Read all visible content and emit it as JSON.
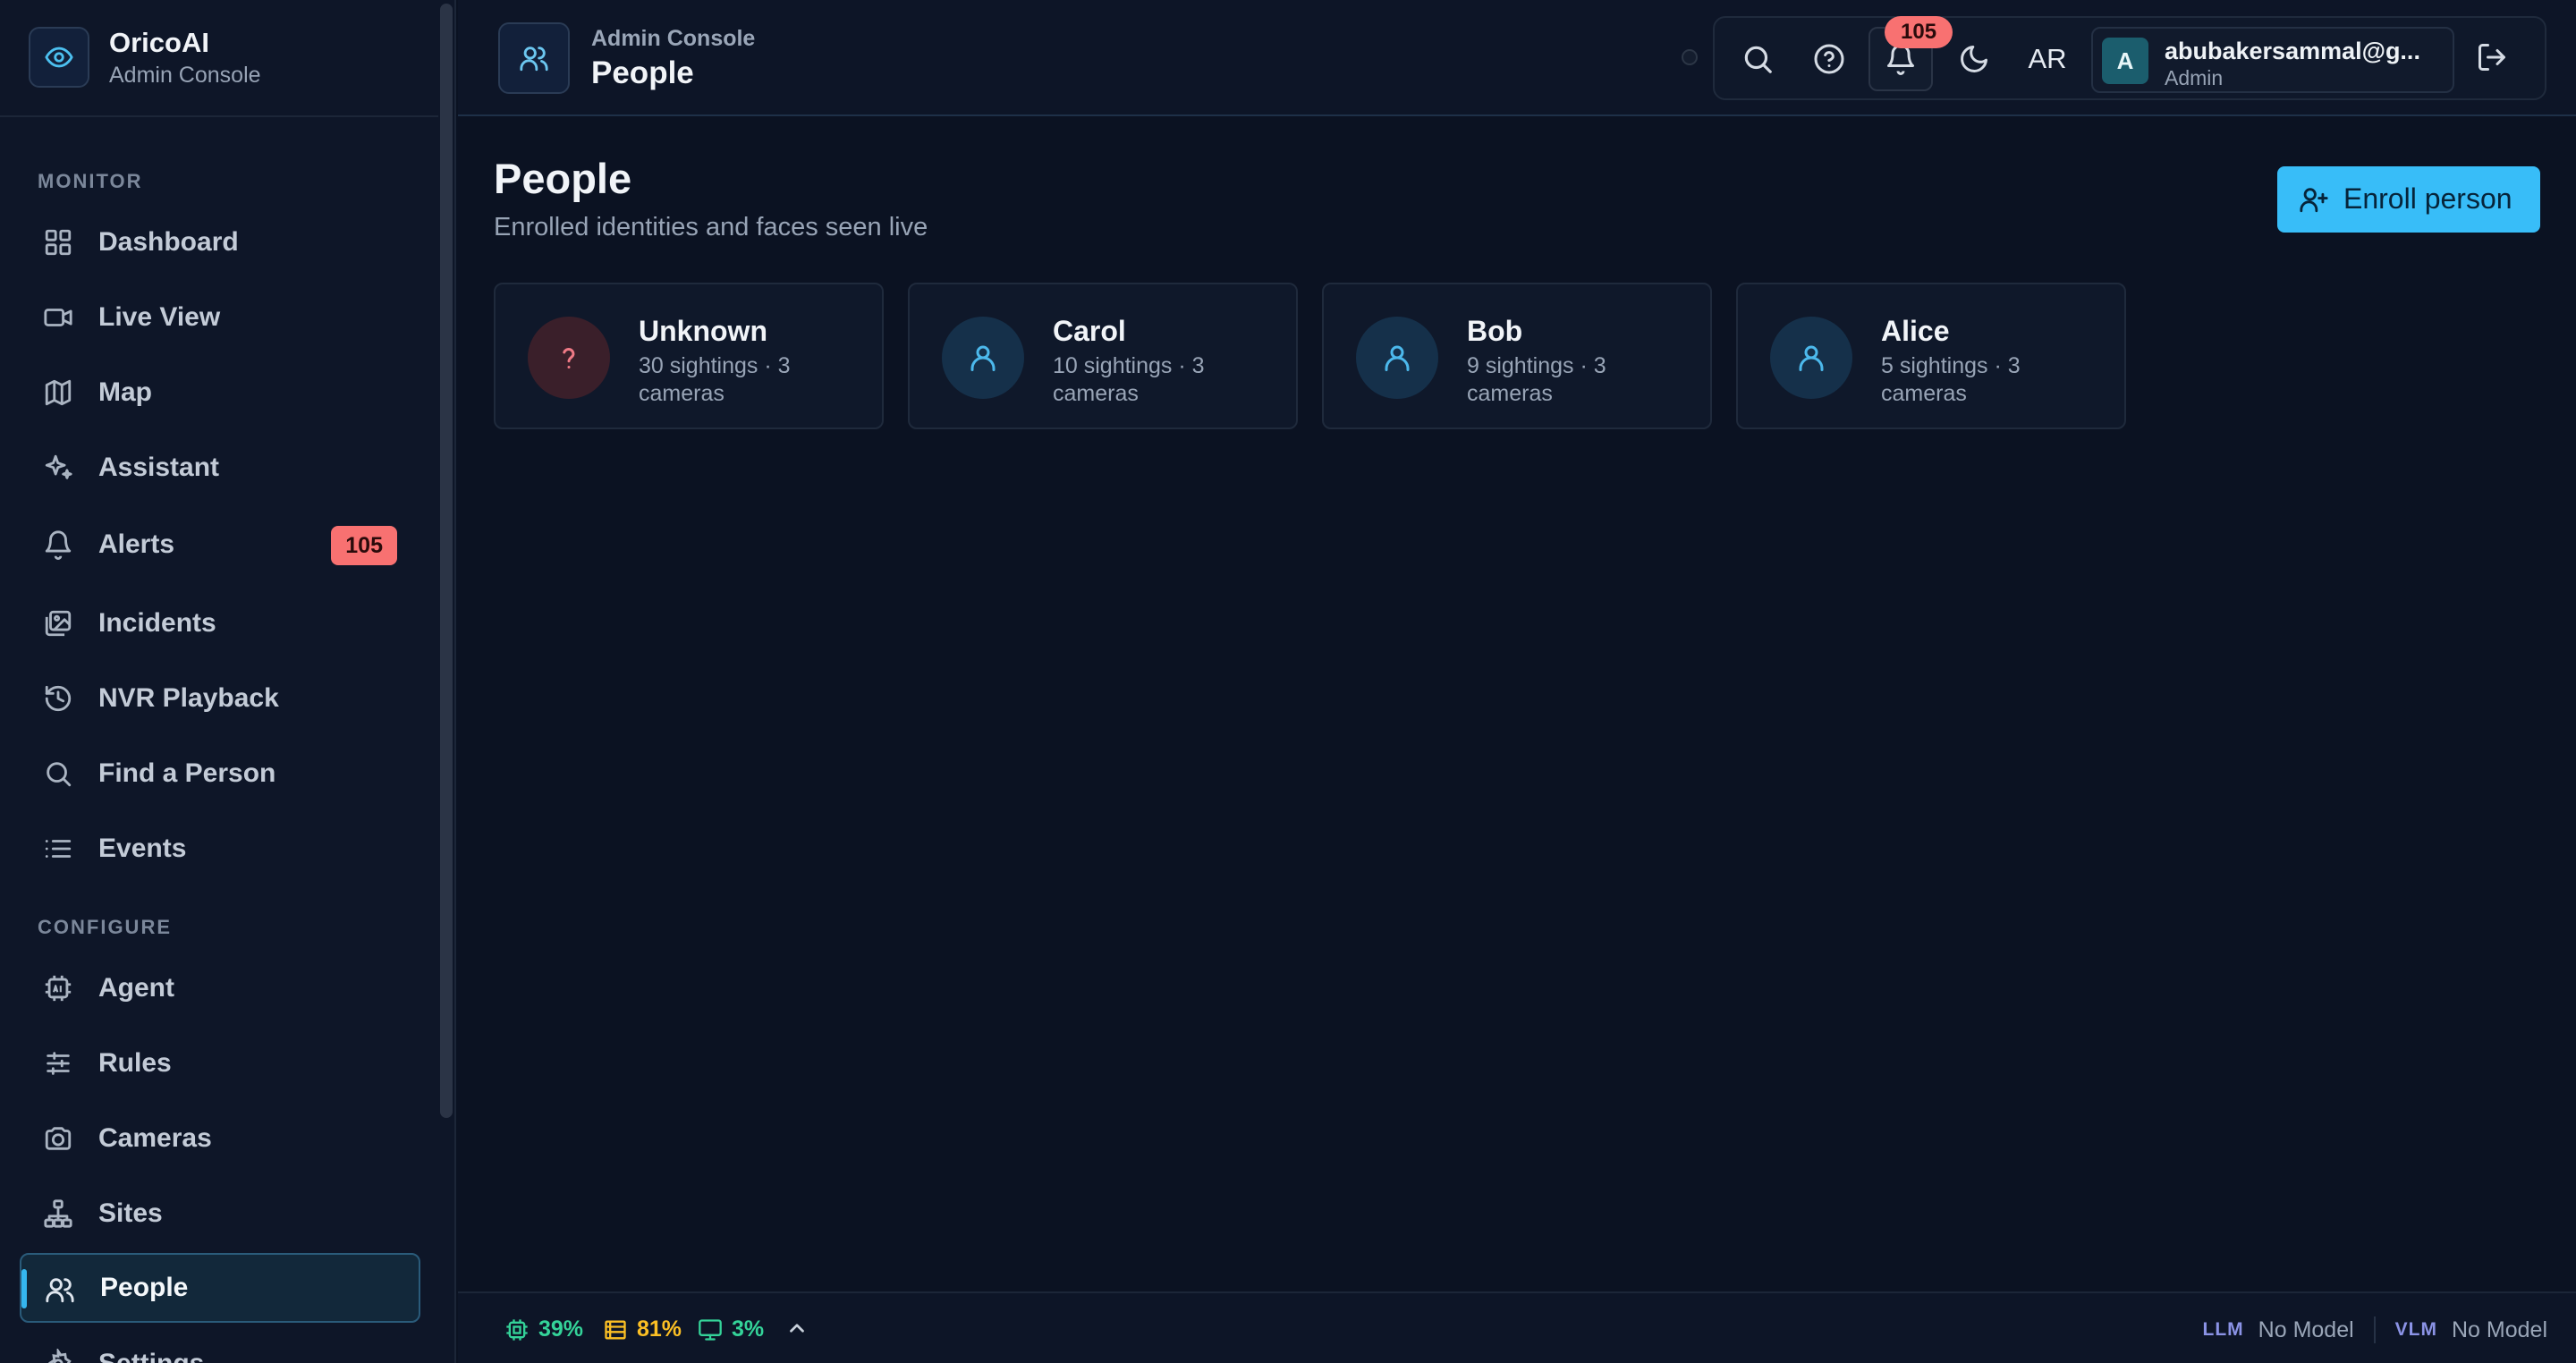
{
  "brand": {
    "name": "OricoAI",
    "subtitle": "Admin Console"
  },
  "sidebar": {
    "sections": [
      {
        "label": "MONITOR"
      },
      {
        "label": "CONFIGURE"
      }
    ],
    "items": [
      {
        "label": "Dashboard",
        "icon": "grid-icon"
      },
      {
        "label": "Live View",
        "icon": "video-camera-icon"
      },
      {
        "label": "Map",
        "icon": "map-icon"
      },
      {
        "label": "Assistant",
        "icon": "sparkles-icon"
      },
      {
        "label": "Alerts",
        "icon": "bell-icon",
        "badge": "105"
      },
      {
        "label": "Incidents",
        "icon": "images-icon"
      },
      {
        "label": "NVR Playback",
        "icon": "history-icon"
      },
      {
        "label": "Find a Person",
        "icon": "search-icon"
      },
      {
        "label": "Events",
        "icon": "list-icon"
      },
      {
        "label": "Agent",
        "icon": "ai-chip-icon"
      },
      {
        "label": "Rules",
        "icon": "sliders-icon"
      },
      {
        "label": "Cameras",
        "icon": "camera-icon"
      },
      {
        "label": "Sites",
        "icon": "network-icon"
      },
      {
        "label": "People",
        "icon": "users-icon",
        "active": true
      },
      {
        "label": "Settings",
        "icon": "gear-icon"
      }
    ]
  },
  "header": {
    "crumb": "Admin Console",
    "title": "People",
    "notifications_count": "105",
    "language": "AR",
    "user": {
      "initial": "A",
      "email": "abubakersammal@g...",
      "role": "Admin"
    }
  },
  "main": {
    "heading": "People",
    "subheading": "Enrolled identities and faces seen live",
    "enroll_label": "Enroll person",
    "people": [
      {
        "name": "Unknown",
        "meta": "30 sightings · 3 cameras",
        "kind": "unknown"
      },
      {
        "name": "Carol",
        "meta": "10 sightings · 3 cameras",
        "kind": "known"
      },
      {
        "name": "Bob",
        "meta": "9 sightings · 3 cameras",
        "kind": "known"
      },
      {
        "name": "Alice",
        "meta": "5 sightings · 3 cameras",
        "kind": "known"
      }
    ]
  },
  "footer": {
    "cpu": "39%",
    "memory": "81%",
    "gpu": "3%",
    "llm_label": "LLM",
    "llm_value": "No Model",
    "vlm_label": "VLM",
    "vlm_value": "No Model",
    "colors": {
      "cpu": "#34d399",
      "memory": "#fbbf24",
      "gpu": "#34d399"
    }
  },
  "colors": {
    "accent": "#38bdf8",
    "badge": "#f87171",
    "background": "#0b1222"
  }
}
